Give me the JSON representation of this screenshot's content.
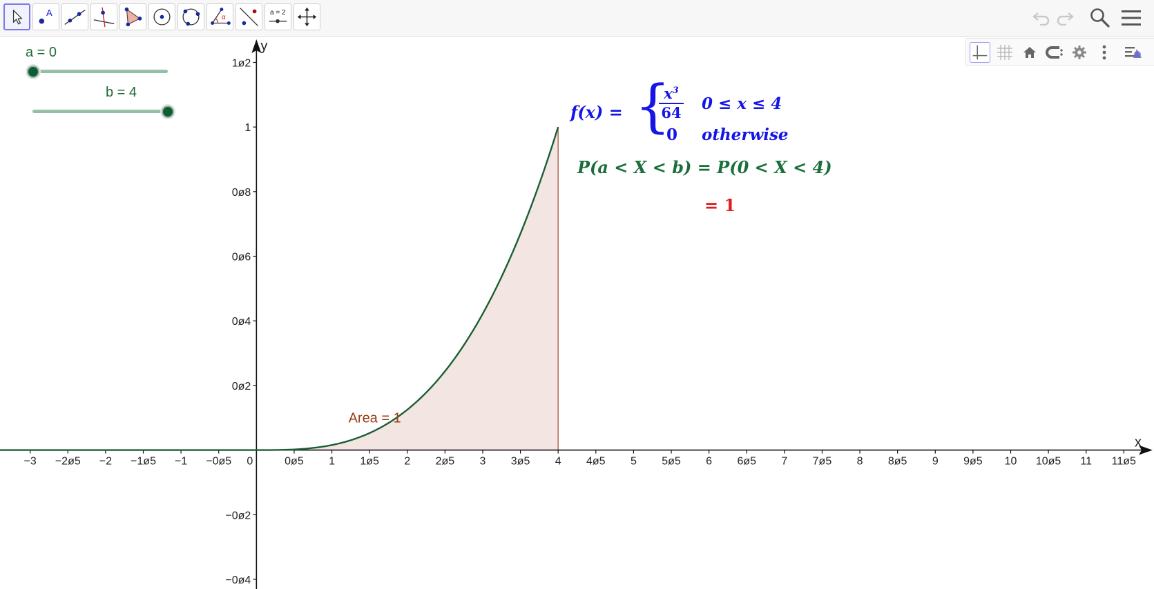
{
  "toolbar": {
    "tools": [
      {
        "name": "move-tool",
        "icon": "cursor-arrow-icon"
      },
      {
        "name": "point-tool",
        "icon": "point-icon",
        "label": "A"
      },
      {
        "name": "line-tool",
        "icon": "line-through-points-icon"
      },
      {
        "name": "perpendicular-line-tool",
        "icon": "perpendicular-line-icon"
      },
      {
        "name": "polygon-tool",
        "icon": "polygon-icon"
      },
      {
        "name": "circle-tool",
        "icon": "circle-center-point-icon"
      },
      {
        "name": "circle-three-points-tool",
        "icon": "circle-three-points-icon"
      },
      {
        "name": "angle-tool",
        "icon": "angle-icon",
        "label": "α"
      },
      {
        "name": "reflect-tool",
        "icon": "reflect-about-line-icon"
      },
      {
        "name": "slider-tool",
        "icon": "slider-icon",
        "label": "a = 2"
      },
      {
        "name": "move-graphics-view-tool",
        "icon": "move-graphics-view-icon"
      }
    ],
    "right_icons": [
      "undo-icon",
      "redo-icon",
      "search-icon",
      "menu-icon"
    ]
  },
  "graphics_bar": [
    "axes-icon",
    "grid-icon",
    "home-icon",
    "point-capturing-icon",
    "settings-icon",
    "more-vertical-icon",
    "style-bar-toggle-icon"
  ],
  "sliders": {
    "a": {
      "label": "a = 0",
      "value": 0
    },
    "b": {
      "label": "b = 4",
      "value": 4
    }
  },
  "definition": {
    "lhs": "f(x) =",
    "case1_expr_num": "x",
    "case1_expr_exp": "3",
    "case1_expr_den": "64",
    "case1_cond": "0 ≤ x ≤ 4",
    "case2_expr": "0",
    "case2_cond": "otherwise"
  },
  "probability": {
    "statement": "P(a < X < b) = P(0 < X < 4)",
    "result": "= 1"
  },
  "area_label": "Area = 1",
  "axes": {
    "x_label": "x",
    "y_label": "y",
    "origin_label": "0"
  },
  "colors": {
    "curve": "#1a5e34",
    "area_fill": "#f3e6e2",
    "area_edge": "#b5735f",
    "definition": "#1515e8",
    "probability": "#1a6e3a",
    "result": "#e01c1c",
    "area_label": "#9a3a10",
    "slider": "#1d6b3a"
  },
  "chart_data": {
    "type": "area",
    "function": "x^3/64 on 0 ≤ x ≤ 4, 0 otherwise",
    "shaded_interval": [
      0,
      4
    ],
    "x": [
      0,
      0.5,
      1,
      1.5,
      2,
      2.5,
      3,
      3.5,
      4
    ],
    "y": [
      0,
      0.00195,
      0.0156,
      0.0527,
      0.125,
      0.244,
      0.422,
      0.67,
      1
    ],
    "xlim": [
      -3.4,
      11.9
    ],
    "ylim": [
      -0.43,
      1.28
    ],
    "x_ticks": [
      {
        "v": -3,
        "t": "−3"
      },
      {
        "v": -2.5,
        "t": "−2ø5"
      },
      {
        "v": -2,
        "t": "−2"
      },
      {
        "v": -1.5,
        "t": "−1ø5"
      },
      {
        "v": -1,
        "t": "−1"
      },
      {
        "v": -0.5,
        "t": "−0ø5"
      },
      {
        "v": 0.5,
        "t": "0ø5"
      },
      {
        "v": 1,
        "t": "1"
      },
      {
        "v": 1.5,
        "t": "1ø5"
      },
      {
        "v": 2,
        "t": "2"
      },
      {
        "v": 2.5,
        "t": "2ø5"
      },
      {
        "v": 3,
        "t": "3"
      },
      {
        "v": 3.5,
        "t": "3ø5"
      },
      {
        "v": 4,
        "t": "4"
      },
      {
        "v": 4.5,
        "t": "4ø5"
      },
      {
        "v": 5,
        "t": "5"
      },
      {
        "v": 5.5,
        "t": "5ø5"
      },
      {
        "v": 6,
        "t": "6"
      },
      {
        "v": 6.5,
        "t": "6ø5"
      },
      {
        "v": 7,
        "t": "7"
      },
      {
        "v": 7.5,
        "t": "7ø5"
      },
      {
        "v": 8,
        "t": "8"
      },
      {
        "v": 8.5,
        "t": "8ø5"
      },
      {
        "v": 9,
        "t": "9"
      },
      {
        "v": 9.5,
        "t": "9ø5"
      },
      {
        "v": 10,
        "t": "10"
      },
      {
        "v": 10.5,
        "t": "10ø5"
      },
      {
        "v": 11,
        "t": "11"
      },
      {
        "v": 11.5,
        "t": "11ø5"
      }
    ],
    "y_ticks": [
      {
        "v": 1.2,
        "t": "1ø2"
      },
      {
        "v": 1,
        "t": "1"
      },
      {
        "v": 0.8,
        "t": "0ø8"
      },
      {
        "v": 0.6,
        "t": "0ø6"
      },
      {
        "v": 0.4,
        "t": "0ø4"
      },
      {
        "v": 0.2,
        "t": "0ø2"
      },
      {
        "v": -0.2,
        "t": "−0ø2"
      },
      {
        "v": -0.4,
        "t": "−0ø4"
      }
    ]
  }
}
